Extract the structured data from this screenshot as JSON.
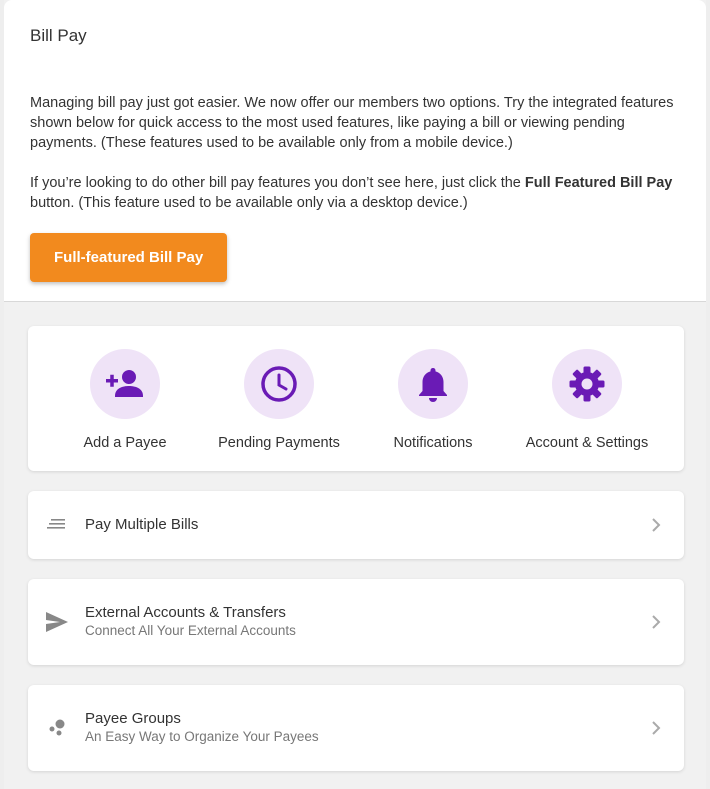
{
  "header": {
    "title": "Bill Pay",
    "paragraph1": "Managing bill pay just got easier. We now offer our members two options. Try the integrated features shown below for quick access to the most used features, like paying a bill or viewing pending payments. (These features used to be available only from a mobile device.)",
    "paragraph2_before": "If you’re looking to do other bill pay features you don’t see here, just click the ",
    "paragraph2_bold": "Full Featured Bill Pay",
    "paragraph2_after": " button. (This feature used to be available only via a desktop device.)",
    "button_label": "Full-featured Bill Pay"
  },
  "quick_actions": [
    {
      "label": "Add a Payee",
      "icon": "add-person-icon"
    },
    {
      "label": "Pending Payments",
      "icon": "clock-icon"
    },
    {
      "label": "Notifications",
      "icon": "bell-icon"
    },
    {
      "label": "Account & Settings",
      "icon": "gear-icon"
    }
  ],
  "rows": [
    {
      "title": "Pay Multiple Bills",
      "subtitle": "",
      "icon": "list-lines-icon"
    },
    {
      "title": "External Accounts & Transfers",
      "subtitle": "Connect All Your External Accounts",
      "icon": "send-icon"
    },
    {
      "title": "Payee Groups",
      "subtitle": "An Easy Way to Organize Your Payees",
      "icon": "dots-group-icon"
    }
  ],
  "colors": {
    "accent": "#f28a1e",
    "icon_purple": "#6a1bb5",
    "icon_circle": "#efe3f7"
  }
}
